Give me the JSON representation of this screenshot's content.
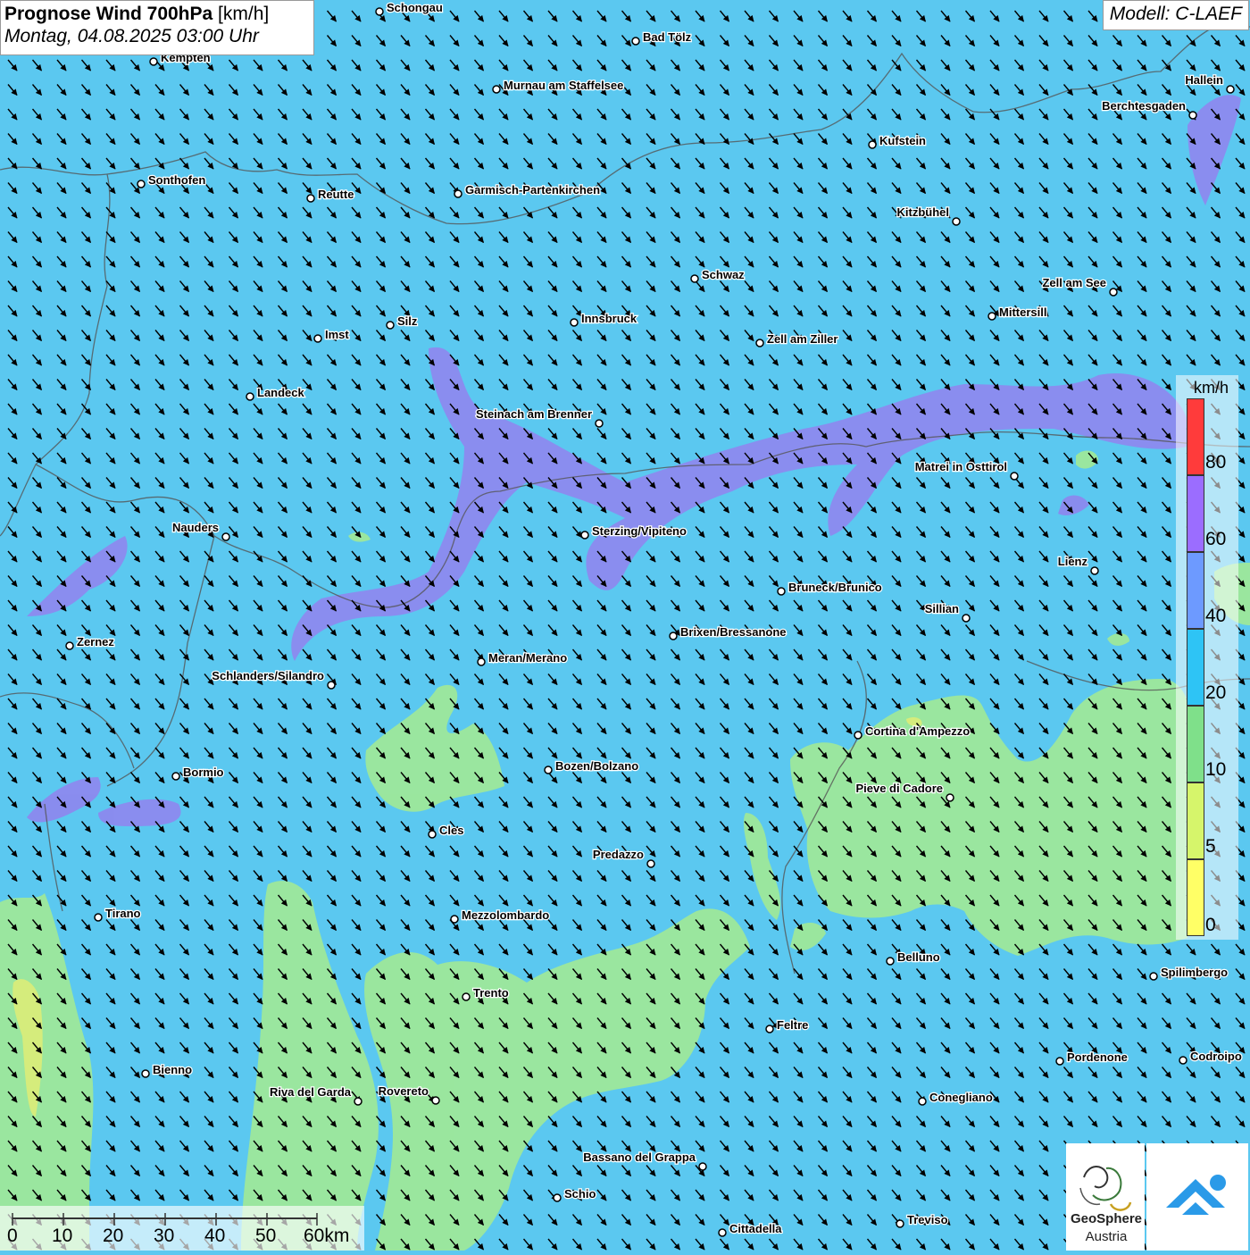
{
  "title": {
    "main": "Prognose Wind 700hPa",
    "unit": "[km/h]",
    "datetime": "Montag, 04.08.2025 03:00 Uhr"
  },
  "model_label": "Modell: C-LAEF",
  "legend": {
    "unit": "km/h",
    "labels": [
      "80",
      "60",
      "40",
      "20",
      "10",
      "5",
      "0"
    ],
    "colors": [
      "#ff3b3b",
      "#9b6dff",
      "#6d9aff",
      "#2ec4f5",
      "#7fe08a",
      "#d6f56b",
      "#ffff66"
    ]
  },
  "scale": {
    "labels": [
      "0",
      "10",
      "20",
      "30",
      "40",
      "50",
      "60km"
    ]
  },
  "cities": [
    "Schongau",
    "Bad Tölz",
    "Kempten",
    "Murnau am Staffelsee",
    "Hallein",
    "Berchtesgaden",
    "Kufstein",
    "Sonthofen",
    "Reutte",
    "Garmisch-Partenkirchen",
    "Kitzbühel",
    "Schwaz",
    "Zell am See",
    "Mittersill",
    "Innsbruck",
    "Silz",
    "Imst",
    "Zell am Ziller",
    "Landeck",
    "Steinach am Brenner",
    "Matrei in Osttirol",
    "Nauders",
    "Sterzing/Vipiteno",
    "Lienz",
    "Bruneck/Brunico",
    "Sillian",
    "Zernez",
    "Brixen/Bressanone",
    "Meran/Merano",
    "Schlanders/Silandro",
    "Cortina d'Ampezzo",
    "Bozen/Bolzano",
    "Bormio",
    "Pieve di Cadore",
    "Cles",
    "Predazzo",
    "Tirano",
    "Mezzolombardo",
    "Belluno",
    "Spilimbergo",
    "Trento",
    "Feltre",
    "Pordenone",
    "Codroipo",
    "Bienno",
    "Riva del Garda",
    "Rovereto",
    "Conegliano",
    "Bassano del Grappa",
    "Schio",
    "Treviso",
    "Cittadella"
  ],
  "logos": {
    "geosphere_line1": "GeoSphere",
    "geosphere_line2": "Austria"
  },
  "colors": {
    "calm": "#9ee89a",
    "moderate": "#5bc8f0",
    "strong": "#8f86ee",
    "weak": "#d8ec7a"
  },
  "icons": {
    "wind_arrow": "arrow-southeast-icon",
    "city_marker": "circle-marker-icon"
  }
}
